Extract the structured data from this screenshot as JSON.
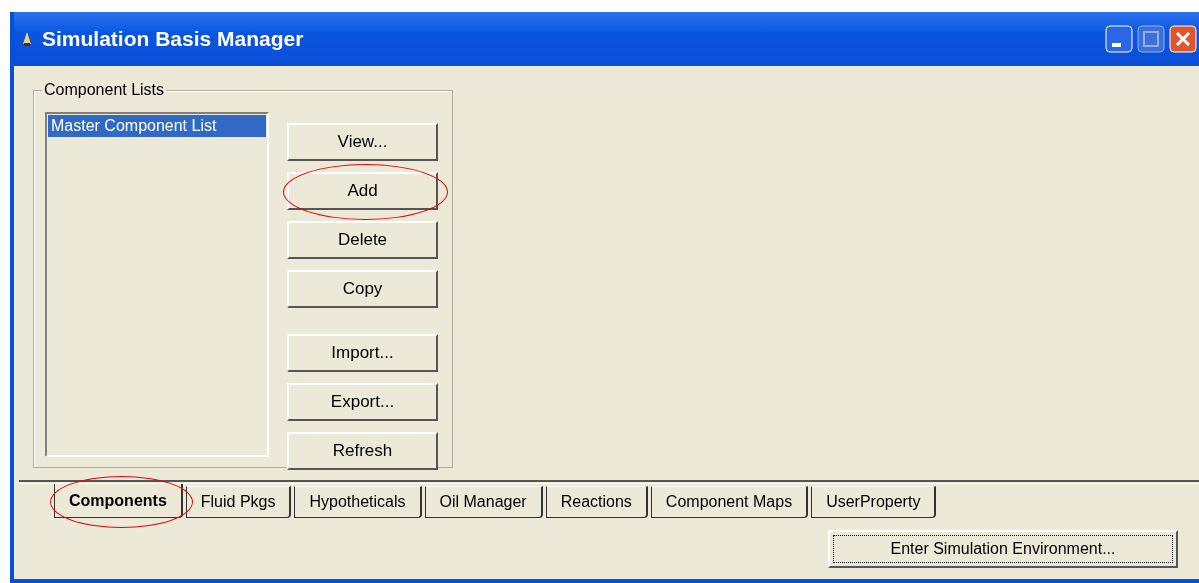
{
  "window": {
    "title": "Simulation Basis Manager"
  },
  "component_lists": {
    "label": "Component Lists",
    "items": [
      {
        "label": "Master Component List",
        "selected": true
      }
    ]
  },
  "button_groups": [
    [
      {
        "label": "View...",
        "circled": false
      },
      {
        "label": "Add",
        "circled": true
      },
      {
        "label": "Delete",
        "circled": false
      },
      {
        "label": "Copy",
        "circled": false
      }
    ],
    [
      {
        "label": "Import...",
        "circled": false
      },
      {
        "label": "Export...",
        "circled": false
      },
      {
        "label": "Refresh",
        "circled": false
      }
    ]
  ],
  "tabs": [
    {
      "label": "Components",
      "selected": true,
      "circled": true
    },
    {
      "label": "Fluid Pkgs",
      "selected": false,
      "circled": false
    },
    {
      "label": "Hypotheticals",
      "selected": false,
      "circled": false
    },
    {
      "label": "Oil Manager",
      "selected": false,
      "circled": false
    },
    {
      "label": "Reactions",
      "selected": false,
      "circled": false
    },
    {
      "label": "Component Maps",
      "selected": false,
      "circled": false
    },
    {
      "label": "UserProperty",
      "selected": false,
      "circled": false
    }
  ],
  "enter_button": {
    "label": "Enter Simulation Environment..."
  }
}
